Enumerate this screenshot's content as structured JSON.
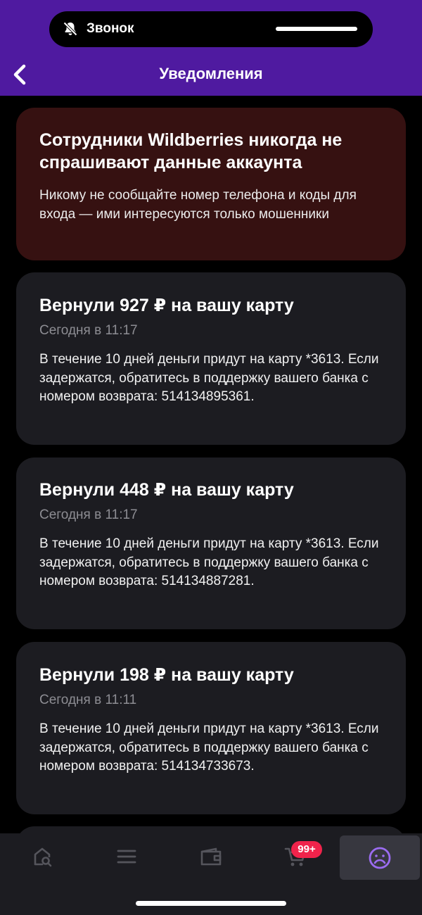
{
  "status_pill": {
    "label": "Звонок"
  },
  "header": {
    "title": "Уведомления"
  },
  "warning": {
    "title": "Сотрудники Wildberries никогда не спрашивают данные аккаунта",
    "text": "Никому не сообщайте номер телефона и коды для входа — ими интересуются только мошенники"
  },
  "notifications": [
    {
      "title": "Вернули 927 ₽ на вашу карту",
      "date": "Сегодня в 11:17",
      "text": "В течение 10 дней деньги придут на карту *3613. Если задержатся, обратитесь в поддержку вашего банка с номером возврата: 514134895361."
    },
    {
      "title": "Вернули 448 ₽ на вашу карту",
      "date": "Сегодня в 11:17",
      "text": "В течение 10 дней деньги придут на карту *3613. Если задержатся, обратитесь в поддержку вашего банка с номером возврата: 514134887281."
    },
    {
      "title": "Вернули 198 ₽ на вашу карту",
      "date": "Сегодня в 11:11",
      "text": "В течение 10 дней деньги придут на карту *3613. Если задержатся, обратитесь в поддержку вашего банка с номером возврата: 514134733673."
    }
  ],
  "nav": {
    "items": [
      {
        "icon": "home-search-icon"
      },
      {
        "icon": "menu-icon"
      },
      {
        "icon": "wallet-icon"
      },
      {
        "icon": "cart-icon"
      },
      {
        "icon": "profile-icon"
      }
    ],
    "cart_badge": "99+"
  },
  "colors": {
    "accent": "#4f1aa0",
    "badge": "#f0234b",
    "card": "#1c1c21",
    "warning_card": "#361111"
  }
}
